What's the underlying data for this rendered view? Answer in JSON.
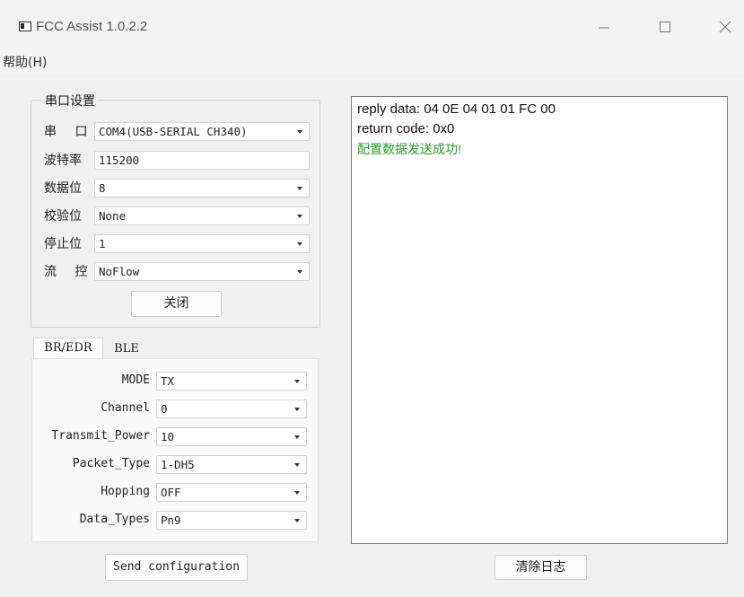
{
  "window": {
    "title": "FCC Assist 1.0.2.2"
  },
  "menu": {
    "help": "帮助(H)"
  },
  "serial": {
    "group_title": "串口设置",
    "port_label": "串 口",
    "port_value": "COM4(USB-SERIAL CH340)",
    "baud_label": "波特率",
    "baud_value": "115200",
    "databits_label": "数据位",
    "databits_value": "8",
    "parity_label": "校验位",
    "parity_value": "None",
    "stopbits_label": "停止位",
    "stopbits_value": "1",
    "flow_label": "流 控",
    "flow_value": "NoFlow",
    "close_button": "关闭"
  },
  "tabs": [
    {
      "label": "BR/EDR",
      "active": true
    },
    {
      "label": "BLE",
      "active": false
    }
  ],
  "params": {
    "mode_label": "MODE",
    "mode_value": "TX",
    "channel_label": "Channel",
    "channel_value": "0",
    "power_label": "Transmit_Power",
    "power_value": "10",
    "packet_label": "Packet_Type",
    "packet_value": "1-DH5",
    "hopping_label": "Hopping",
    "hopping_value": "OFF",
    "datatypes_label": "Data_Types",
    "datatypes_value": "Pn9"
  },
  "send_button": "Send configuration",
  "log": {
    "lines": [
      "reply data: 04 0E 04 01 01 FC 00",
      "return code: 0x0",
      "配置数据发送成功!"
    ],
    "success_color": "#2e9a2e"
  },
  "clear_button": "清除日志",
  "icons": {
    "app": "app-window-icon",
    "minimize": "minimize-icon",
    "maximize": "maximize-icon",
    "close": "close-icon",
    "dropdown": "chevron-down-icon"
  }
}
